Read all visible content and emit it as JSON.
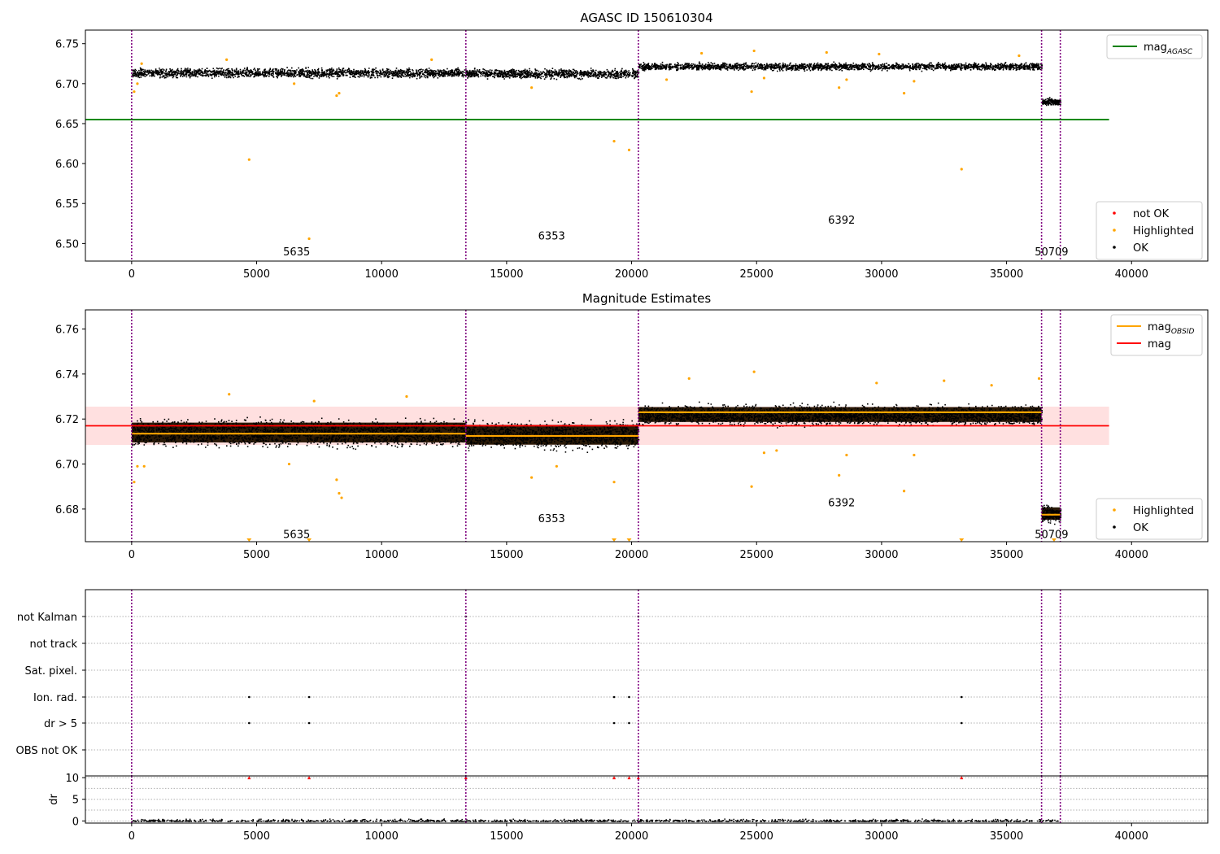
{
  "chart_data": [
    {
      "type": "scatter",
      "title": "AGASC ID 150610304",
      "x_ticks": [
        0,
        5000,
        10000,
        15000,
        20000,
        25000,
        30000,
        35000,
        40000
      ],
      "y_ticks": [
        6.5,
        6.55,
        6.6,
        6.65,
        6.7,
        6.75
      ],
      "xlim": [
        -1850,
        43050
      ],
      "ylim": [
        6.478,
        6.767
      ],
      "obs_boundaries": [
        0,
        13370,
        20270,
        36400,
        37150
      ],
      "obs_labels": [
        {
          "text": "5635",
          "x": 6600,
          "y": 6.49
        },
        {
          "text": "6353",
          "x": 16800,
          "y": 6.51
        },
        {
          "text": "6392",
          "x": 28400,
          "y": 6.53
        },
        {
          "text": "50709",
          "x": 36800,
          "y": 6.49
        }
      ],
      "ok_bands": [
        {
          "x": [
            0,
            13370
          ],
          "center": 6.714,
          "halfwidth": 0.008
        },
        {
          "x": [
            13370,
            20270
          ],
          "center": 6.713,
          "halfwidth": 0.008
        },
        {
          "x": [
            20270,
            36400
          ],
          "center": 6.722,
          "halfwidth": 0.006
        },
        {
          "x": [
            36400,
            37150
          ],
          "center": 6.678,
          "halfwidth": 0.006
        }
      ],
      "mag_agasc": {
        "value": 6.655,
        "x": [
          -1850,
          39100
        ],
        "color": "#008000"
      },
      "highlighted_points": [
        [
          100,
          6.69
        ],
        [
          230,
          6.7
        ],
        [
          400,
          6.725
        ],
        [
          4700,
          6.605
        ],
        [
          6500,
          6.7
        ],
        [
          7100,
          6.506
        ],
        [
          8200,
          6.685
        ],
        [
          8300,
          6.688
        ],
        [
          16000,
          6.695
        ],
        [
          19300,
          6.628
        ],
        [
          19900,
          6.617
        ],
        [
          21400,
          6.705
        ],
        [
          24800,
          6.69
        ],
        [
          25300,
          6.707
        ],
        [
          28300,
          6.695
        ],
        [
          28600,
          6.705
        ],
        [
          30900,
          6.688
        ],
        [
          31300,
          6.703
        ],
        [
          33200,
          6.593
        ],
        [
          3800,
          6.73
        ],
        [
          12000,
          6.73
        ],
        [
          22800,
          6.738
        ],
        [
          24900,
          6.741
        ],
        [
          27800,
          6.739
        ],
        [
          29900,
          6.737
        ],
        [
          35500,
          6.735
        ]
      ],
      "legends": [
        {
          "position": "upper-right",
          "entries": [
            {
              "label": "mag",
              "sub": "AGASC",
              "color": "#008000",
              "kind": "line"
            }
          ]
        },
        {
          "position": "lower-right",
          "entries": [
            {
              "label": "not OK",
              "color": "#ff0000",
              "kind": "dot"
            },
            {
              "label": "Highlighted",
              "color": "#ffa500",
              "kind": "dot"
            },
            {
              "label": "OK",
              "color": "#000000",
              "kind": "dot"
            }
          ]
        }
      ]
    },
    {
      "type": "scatter",
      "title": "Magnitude Estimates",
      "x_ticks": [
        0,
        5000,
        10000,
        15000,
        20000,
        25000,
        30000,
        35000,
        40000
      ],
      "y_ticks": [
        6.68,
        6.7,
        6.72,
        6.74,
        6.76
      ],
      "xlim": [
        -1850,
        43050
      ],
      "ylim": [
        6.6655,
        6.7685
      ],
      "obs_boundaries": [
        0,
        13370,
        20270,
        36400,
        37150
      ],
      "obs_labels": [
        {
          "text": "5635",
          "x": 6600,
          "y": 6.669
        },
        {
          "text": "6353",
          "x": 16800,
          "y": 6.676
        },
        {
          "text": "6392",
          "x": 28400,
          "y": 6.683
        },
        {
          "text": "50709",
          "x": 36800,
          "y": 6.669
        }
      ],
      "ok_bands": [
        {
          "x": [
            0,
            13370
          ],
          "center": 6.714,
          "halfwidth": 0.008
        },
        {
          "x": [
            13370,
            20270
          ],
          "center": 6.713,
          "halfwidth": 0.008
        },
        {
          "x": [
            20270,
            36400
          ],
          "center": 6.722,
          "halfwidth": 0.006
        },
        {
          "x": [
            36400,
            37150
          ],
          "center": 6.678,
          "halfwidth": 0.005
        }
      ],
      "mag_obsid": [
        {
          "x": [
            0,
            13370
          ],
          "value": 6.7135
        },
        {
          "x": [
            13370,
            20270
          ],
          "value": 6.7125
        },
        {
          "x": [
            20270,
            36400
          ],
          "value": 6.723
        },
        {
          "x": [
            36400,
            37150
          ],
          "value": 6.6775
        }
      ],
      "mag": {
        "value": 6.717,
        "band": [
          6.7085,
          6.7255
        ],
        "x": [
          -1850,
          39100
        ]
      },
      "highlighted_points": [
        [
          100,
          6.692
        ],
        [
          230,
          6.699
        ],
        [
          500,
          6.699
        ],
        [
          3900,
          6.731
        ],
        [
          6300,
          6.7
        ],
        [
          7300,
          6.728
        ],
        [
          8200,
          6.693
        ],
        [
          8300,
          6.687
        ],
        [
          8400,
          6.685
        ],
        [
          11000,
          6.73
        ],
        [
          16000,
          6.694
        ],
        [
          17000,
          6.699
        ],
        [
          19300,
          6.692
        ],
        [
          22300,
          6.738
        ],
        [
          24900,
          6.741
        ],
        [
          24800,
          6.69
        ],
        [
          25300,
          6.705
        ],
        [
          25800,
          6.706
        ],
        [
          28300,
          6.695
        ],
        [
          28600,
          6.704
        ],
        [
          29800,
          6.736
        ],
        [
          30900,
          6.688
        ],
        [
          31300,
          6.704
        ],
        [
          32500,
          6.737
        ],
        [
          34400,
          6.735
        ],
        [
          36300,
          6.738
        ]
      ],
      "clipped_markers": [
        4700,
        7100,
        19300,
        19900,
        33200,
        36900
      ],
      "legends": [
        {
          "position": "upper-right",
          "entries": [
            {
              "label": "mag",
              "sub": "OBSID",
              "color": "#ffa500",
              "kind": "line"
            },
            {
              "label": "mag",
              "color": "#ff0000",
              "kind": "line"
            }
          ]
        },
        {
          "position": "lower-right",
          "entries": [
            {
              "label": "Highlighted",
              "color": "#ffa500",
              "kind": "dot"
            },
            {
              "label": "OK",
              "color": "#000000",
              "kind": "dot"
            }
          ]
        }
      ]
    },
    {
      "type": "scatter",
      "title": "",
      "categories": [
        "not Kalman",
        "not track",
        "Sat. pixel.",
        "Ion. rad.",
        "dr > 5",
        "OBS not OK"
      ],
      "xlim": [
        -1850,
        43050
      ],
      "obs_boundaries": [
        0,
        13370,
        20270,
        36400,
        37150
      ],
      "flag_points": [
        {
          "category": "not Kalman",
          "x": [
            13370,
            20270
          ]
        },
        {
          "category": "Ion. rad.",
          "x": [
            4700,
            7100,
            19300,
            19900,
            33200
          ]
        },
        {
          "category": "dr > 5",
          "x": [
            4700,
            7100,
            19300,
            19900,
            33200
          ]
        }
      ]
    },
    {
      "type": "scatter",
      "title": "",
      "ylabel": "dr",
      "x_ticks": [
        0,
        5000,
        10000,
        15000,
        20000,
        25000,
        30000,
        35000,
        40000
      ],
      "y_ticks": [
        0,
        5,
        10
      ],
      "xlim": [
        -1850,
        43050
      ],
      "ylim": [
        -0.5,
        10.4
      ],
      "obs_boundaries": [
        0,
        13370,
        20270,
        36400,
        37150
      ],
      "dr_clipped": [
        4700,
        7100,
        13370,
        19300,
        19900,
        20270,
        33200
      ],
      "dr_range": [
        0,
        37150
      ],
      "dr_noise": [
        0.0,
        0.6
      ]
    }
  ]
}
